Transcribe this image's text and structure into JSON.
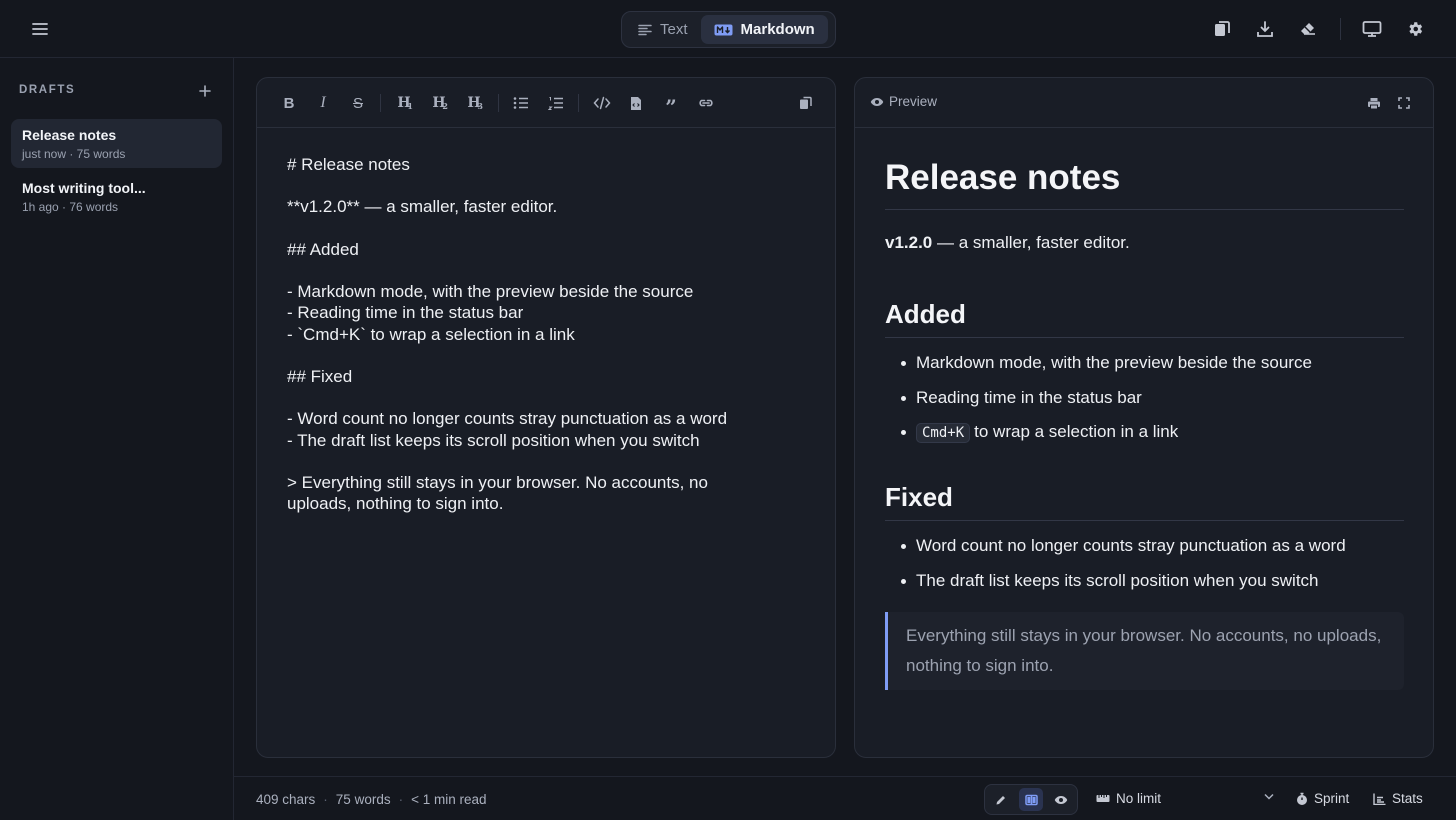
{
  "colors": {
    "background": "#14171e",
    "panel": "#191d26",
    "accent": "#7f9cf5",
    "text": "#eef0f4",
    "muted": "#9aa1b0"
  },
  "topbar": {
    "menu_icon": "hamburger-menu-icon",
    "modes": [
      {
        "label": "Text",
        "icon": "text-lines-icon",
        "active": false
      },
      {
        "label": "Markdown",
        "icon": "markdown-icon",
        "active": true
      }
    ],
    "actions": [
      "copy-icon",
      "download-icon",
      "eraser-icon",
      "monitor-icon",
      "gear-icon"
    ]
  },
  "sidebar": {
    "heading": "DRAFTS",
    "drafts": [
      {
        "title": "Release notes",
        "meta": "just now · 75 words",
        "active": true
      },
      {
        "title": "Most writing tool...",
        "meta": "1h ago · 76 words",
        "active": false
      }
    ]
  },
  "editor": {
    "toolbar": [
      "bold-icon",
      "italic-icon",
      "strikethrough-icon",
      "heading-1-icon",
      "heading-2-icon",
      "heading-3-icon",
      "bullet-list-icon",
      "numbered-list-icon",
      "code-icon",
      "code-block-icon",
      "quote-icon",
      "link-icon",
      "copy-icon"
    ],
    "lines": [
      "# Release notes",
      "",
      "**v1.2.0** — a smaller, faster editor.",
      "",
      "## Added",
      "",
      "- Markdown mode, with the preview beside the source",
      "- Reading time in the status bar",
      "- `Cmd+K` to wrap a selection in a link",
      "",
      "## Fixed",
      "",
      "- Word count no longer counts stray punctuation as a word",
      "- The draft list keeps its scroll position when you switch",
      "",
      "> Everything still stays in your browser. No accounts, no",
      "uploads, nothing to sign into."
    ]
  },
  "preview": {
    "label": "Preview",
    "h1": "Release notes",
    "version": "v1.2.0",
    "tagline": " — a smaller, faster editor.",
    "added_heading": "Added",
    "added_items": [
      "Markdown mode, with the preview beside the source",
      "Reading time in the status bar"
    ],
    "added_code": "Cmd+K",
    "added_code_rest": "to wrap a selection in a link",
    "fixed_heading": "Fixed",
    "fixed_items": [
      "Word count no longer counts stray punctuation as a word",
      "The draft list keeps its scroll position when you switch"
    ],
    "quote": "Everything still stays in your browser. No accounts, no uploads, nothing to sign into."
  },
  "status": {
    "chars": "409 chars",
    "words": "75 words",
    "read": "< 1 min read",
    "separator": "·",
    "goal": "No limit",
    "sprint": "Sprint",
    "stats": "Stats"
  }
}
